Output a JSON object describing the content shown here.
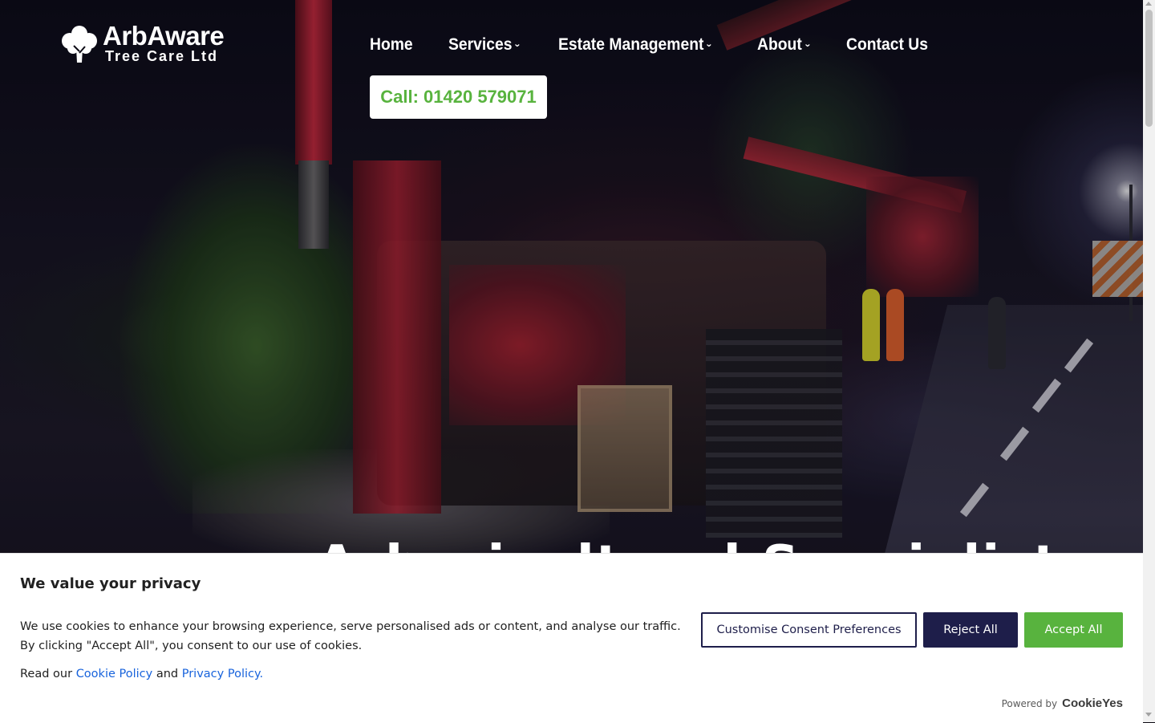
{
  "logo": {
    "main": "ArbAware",
    "sub": "Tree Care Ltd"
  },
  "nav": {
    "items": [
      {
        "label": "Home",
        "has_dropdown": false
      },
      {
        "label": "Services",
        "has_dropdown": true
      },
      {
        "label": "Estate Management",
        "has_dropdown": true
      },
      {
        "label": "About",
        "has_dropdown": true
      },
      {
        "label": "Contact Us",
        "has_dropdown": false
      }
    ],
    "chevron_icon": "chevron-down-icon"
  },
  "call_button": {
    "label": "Call: 01420 579071"
  },
  "hero": {
    "heading_partial": "Arboricultural Specialists"
  },
  "cookie_banner": {
    "title": "We value your privacy",
    "description": "We use cookies to enhance your browsing experience, serve personalised ads or content, and analyse our traffic. By clicking \"Accept All\", you consent to our use of cookies.",
    "read_prefix": "Read our",
    "cookie_policy_link": "Cookie Policy",
    "and_text": "and",
    "privacy_policy_link": "Privacy Policy.",
    "customise_button": "Customise Consent Preferences",
    "reject_button": "Reject All",
    "accept_button": "Accept All",
    "powered_by": "Powered by",
    "powered_brand": "CookieYes"
  },
  "colors": {
    "accent_green": "#58b33e",
    "navy": "#1e1e4a",
    "link_blue": "#1863dc",
    "white": "#ffffff"
  }
}
